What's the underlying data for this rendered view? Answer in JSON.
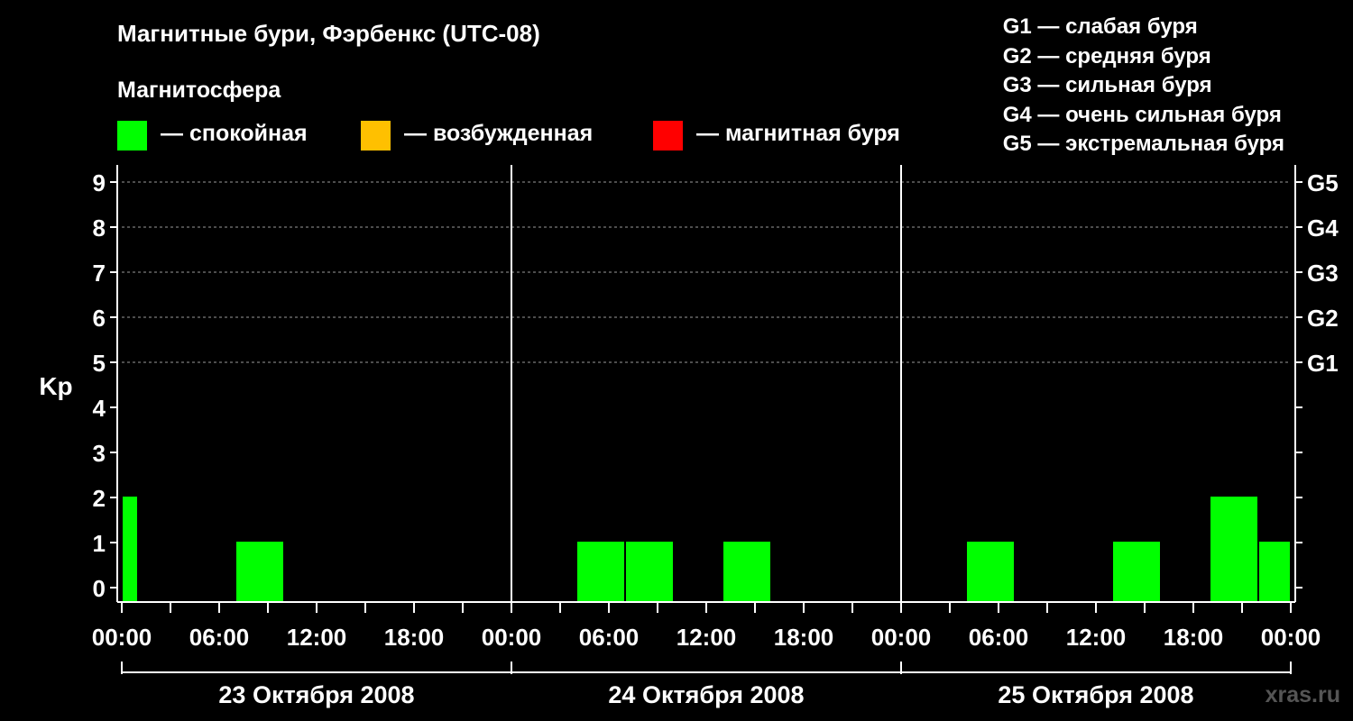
{
  "title": "Магнитные бури, Фэрбенкс (UTC-08)",
  "magnetosphere": {
    "title": "Магнитосфера",
    "items": [
      {
        "label": "— спокойная",
        "color": "#00ff00"
      },
      {
        "label": "— возбужденная",
        "color": "#ffc000"
      },
      {
        "label": "— магнитная буря",
        "color": "#ff0000"
      }
    ]
  },
  "g_scale": [
    "G1 — слабая буря",
    "G2 — средняя буря",
    "G3 — сильная буря",
    "G4 — очень сильная буря",
    "G5 — экстремальная буря"
  ],
  "watermark": "xras.ru",
  "chart_data": {
    "type": "bar",
    "ylabel": "Kp",
    "ylim": [
      0,
      9
    ],
    "yticks": [
      "0",
      "1",
      "2",
      "3",
      "4",
      "5",
      "6",
      "7",
      "8",
      "9"
    ],
    "right_ticks": [
      {
        "kp": 5,
        "label": "G1"
      },
      {
        "kp": 6,
        "label": "G2"
      },
      {
        "kp": 7,
        "label": "G3"
      },
      {
        "kp": 8,
        "label": "G4"
      },
      {
        "kp": 9,
        "label": "G5"
      }
    ],
    "xticks": [
      "00:00",
      "06:00",
      "12:00",
      "18:00",
      "00:00",
      "06:00",
      "12:00",
      "18:00",
      "00:00",
      "06:00",
      "12:00",
      "18:00",
      "00:00"
    ],
    "days": [
      "23 Октября 2008",
      "24 Октября 2008",
      "25 Октября 2008"
    ],
    "grid": true,
    "series": [
      {
        "color": "#00ff00",
        "bars": [
          {
            "start_hour": 0,
            "end_hour": 1,
            "kp": 2
          },
          {
            "start_hour": 7,
            "end_hour": 10,
            "kp": 1
          },
          {
            "start_hour": 28,
            "end_hour": 31,
            "kp": 1
          },
          {
            "start_hour": 31,
            "end_hour": 34,
            "kp": 1
          },
          {
            "start_hour": 37,
            "end_hour": 40,
            "kp": 1
          },
          {
            "start_hour": 52,
            "end_hour": 55,
            "kp": 1
          },
          {
            "start_hour": 61,
            "end_hour": 64,
            "kp": 1
          },
          {
            "start_hour": 67,
            "end_hour": 70,
            "kp": 2
          },
          {
            "start_hour": 70,
            "end_hour": 72,
            "kp": 1
          }
        ]
      }
    ]
  }
}
